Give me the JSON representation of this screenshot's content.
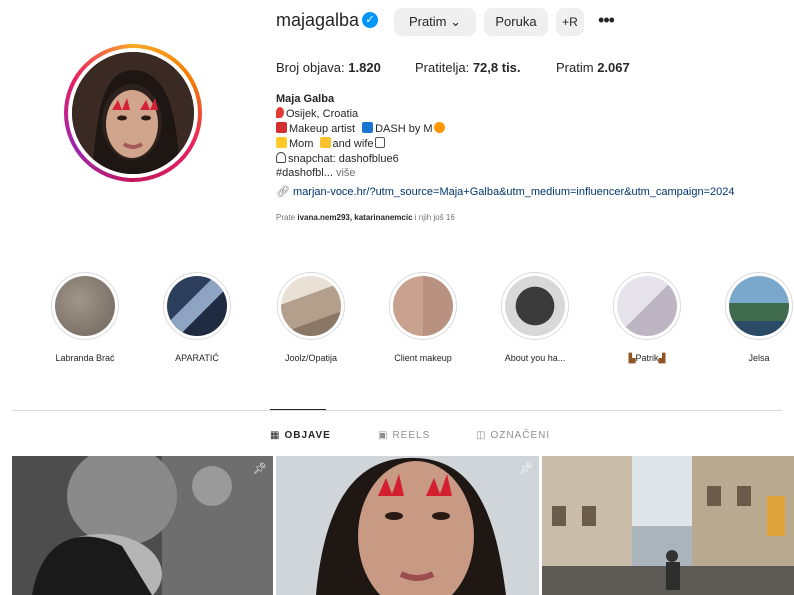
{
  "profile": {
    "username": "majagalba",
    "verified_icon": "verified-badge-icon",
    "follow_label": "Pratim",
    "message_label": "Poruka",
    "add_user_label": "+R",
    "more_label": "•••"
  },
  "stats": {
    "posts_label": "Broj objava:",
    "posts_value": "1.820",
    "followers_label": "Pratitelja:",
    "followers_value": "72,8 tis.",
    "following_label": "Pratim",
    "following_value": "2.067"
  },
  "bio": {
    "name": "Maja Galba",
    "line1": "Osijek, Croatia",
    "line2a": "Makeup artist",
    "line2b": "DASH by M",
    "line3a": "Mom",
    "line3b": "and wife",
    "line4": "snapchat: dashofblue6",
    "line5": "#dashofbl...",
    "more": "više",
    "link": "marjan-voce.hr/?utm_source=Maja+Galba&utm_medium=influencer&utm_campaign=2024",
    "followed_prefix": "Prate",
    "followed_names": "ivana.nem293, katarinanemcic",
    "followed_suffix": "i njih još 16"
  },
  "highlights": [
    {
      "label": "Labranda Brać",
      "color": "#8a7f73"
    },
    {
      "label": "APARATIĆ",
      "color": "#3b4a66"
    },
    {
      "label": "Joolz/Opatija",
      "color": "#b7a899"
    },
    {
      "label": "Client makeup",
      "color": "#a8887a"
    },
    {
      "label": "About you ha...",
      "color": "#5c5c5c"
    },
    {
      "label": "Patrik",
      "color": "#c9c4cc"
    },
    {
      "label": "Jelsa",
      "color": "#5e7d96"
    }
  ],
  "tabs": [
    {
      "label": "OBJAVE",
      "icon": "grid-icon"
    },
    {
      "label": "REELS",
      "icon": "reels-icon"
    },
    {
      "label": "OZNAČENI",
      "icon": "tagged-icon"
    }
  ],
  "colors": {
    "accent": "#0095f6",
    "link": "#00376b",
    "button_bg": "#efefef"
  }
}
